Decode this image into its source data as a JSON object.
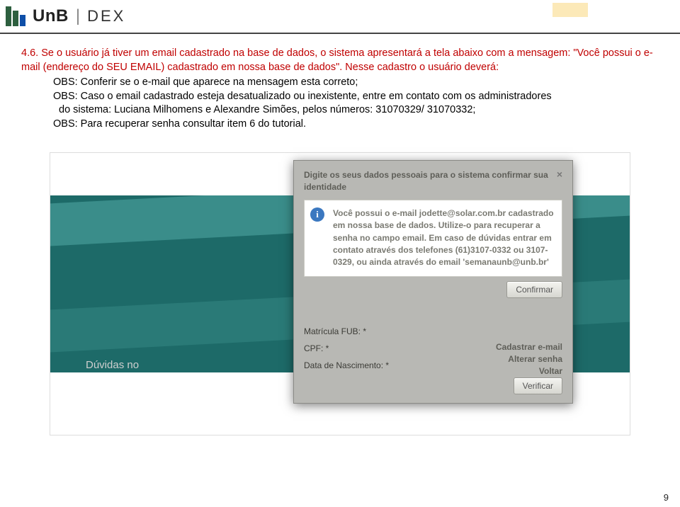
{
  "header": {
    "unb": "UnB",
    "dex": "DEX"
  },
  "section": {
    "heading_pt1": "4.6. Se o usuário já tiver um email cadastrado na base de dados, o  sistema apresentará a tela abaixo com a mensagem: \"Você possui o e-mail (endereço do SEU EMAIL) cadastrado em nossa base de dados\". Nesse cadastro o usuário deverá:",
    "obs1": "OBS: Conferir se o e-mail que aparece na mensagem esta correto;",
    "obs2": "OBS: Caso o email cadastrado esteja desatualizado ou inexistente, entre em contato com os administradores",
    "obs2b": "do sistema: Luciana Milhomens e Alexandre Simões, pelos  números: 31070329/ 31070332;",
    "obs3": "OBS: Para recuperar senha consultar item 6 do tutorial."
  },
  "dialog": {
    "title": "Digite os seus dados pessoais para o sistema confirmar sua identidade",
    "close": "×",
    "info_icon": "i",
    "info_text": "Você possui o e-mail jodette@solar.com.br cadastrado em nossa base de dados. Utilize-o para recuperar a senha no campo email. Em caso de dúvidas entrar em contato através dos telefones (61)3107-0332 ou 3107-0329, ou ainda através do email 'semanaunb@unb.br'",
    "confirmar": "Confirmar",
    "links": {
      "cadastrar": "Cadastrar e-mail",
      "alterar": "Alterar senha",
      "voltar": "Voltar"
    },
    "fields": {
      "matricula": "Matrícula FUB: *",
      "cpf": "CPF: *",
      "data": "Data de Nascimento: *"
    },
    "verificar": "Verificar"
  },
  "bg": {
    "duvidas": "Dúvidas no"
  },
  "page_number": "9"
}
